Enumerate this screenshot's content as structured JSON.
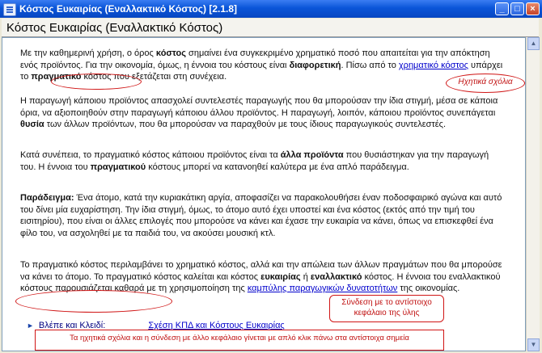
{
  "window": {
    "title": "Κόστος Ευκαιρίας (Εναλλακτικό Κόστος)    [2.1.8]"
  },
  "header": {
    "title": "Κόστος Ευκαιρίας (Εναλλακτικό Κόστος)"
  },
  "p1": {
    "t1": "Με την καθημερινή χρήση, ο όρος ",
    "b1": "κόστος",
    "t2": " σημαίνει ένα συγκεκριμένο χρηματικό ποσό που απαιτείται για την απόκτηση ενός προϊόντος. Για την οικονομία, όμως, η έννοια του κόστους είναι ",
    "b2": "διαφορετική",
    "t3": ". Πίσω από το ",
    "link": "χρηματικό κόστος",
    "t4": " υπάρχει το ",
    "b3": "πραγματικό",
    "t5": " κόστος που εξετάζεται στη συνέχεια."
  },
  "p2": {
    "t1": "Η παραγωγή κάποιου προϊόντος απασχολεί συντελεστές παραγωγής που θα μπορούσαν την ίδια στιγμή, μέσα σε κάποια όρια, να αξιοποιηθούν στην παραγωγή κάποιου άλλου προϊόντος. Η παραγωγή, λοιπόν, κάποιου προϊόντος συνεπάγεται ",
    "b1": "θυσία",
    "t2": " των άλλων προϊόντων, που θα μπορούσαν να παραχθούν με τους ίδιους παραγωγικούς συντελεστές."
  },
  "p3": {
    "t1": "Κατά συνέπεια, το πραγματικό κόστος κάποιου προϊόντος είναι τα ",
    "b1": "άλλα προϊόντα",
    "t2": " που θυσιάστηκαν για την παραγωγή του. Η έννοια του ",
    "b2": "πραγματικού",
    "t3": " κόστους μπορεί να κατανοηθεί καλύτερα με ένα απλό παράδειγμα."
  },
  "p4": {
    "b1": "Παράδειγμα:",
    "t1": " Ένα άτομο, κατά την κυριακάτικη αργία, αποφασίζει να παρακολουθήσει έναν ποδοσφαιρικό αγώνα και αυτό του δίνει μία ευχαρίστηση. Την ίδια στιγμή, όμως, το άτομο αυτό έχει υποστεί και ένα κόστος (εκτός από την τιμή του εισιτηρίου), που είναι οι άλλες επιλογές που μπορούσε να κάνει και έχασε την ευκαιρία να κάνει, όπως να επισκεφθεί ένα φίλο του, να ασχοληθεί με τα παιδιά του, να ακούσει μουσική κτλ."
  },
  "p5": {
    "t1": "Το πραγματικό κόστος περιλαμβάνει το χρηματικό κόστος, αλλά και την απώλεια των άλλων πραγμάτων που θα μπορούσε να κάνει το άτομο. Το πραγματικό κόστος καλείται και κόστος ",
    "b1": "ευκαιρίας",
    "t2": " ή ",
    "b2": "εναλλακτικό",
    "t3": " κόστος. Η έννοια του εναλλακτικού κόστους παρουσιάζεται καθαρά με τη χρησιμοποίηση της ",
    "link": "καμπύλης παραγωγικών δυνατοτήτων",
    "t4": " της οικονομίας."
  },
  "see_also": {
    "label": "Βλέπε και Κλειδί:",
    "link": "Σχέση ΚΠΔ και Κόστους Ευκαιρίας"
  },
  "annotations": {
    "audio_note": "Ηχητικά σχόλια",
    "link_note": "Σύνδεση με το αντίστοιχο κεφάλαιο της ύλης",
    "bottom_note": "Τα ηχητικά σχόλια και η σύνδεση με άλλο κεφάλαιο γίνεται με απλό κλικ πάνω στα αντίστοιχα σημεία"
  },
  "window_buttons": {
    "minimize": "_",
    "maximize": "□",
    "close": "×"
  },
  "colors": {
    "titlebar": "#0a55d8",
    "link": "#0000cc",
    "annotation": "#d01515"
  }
}
